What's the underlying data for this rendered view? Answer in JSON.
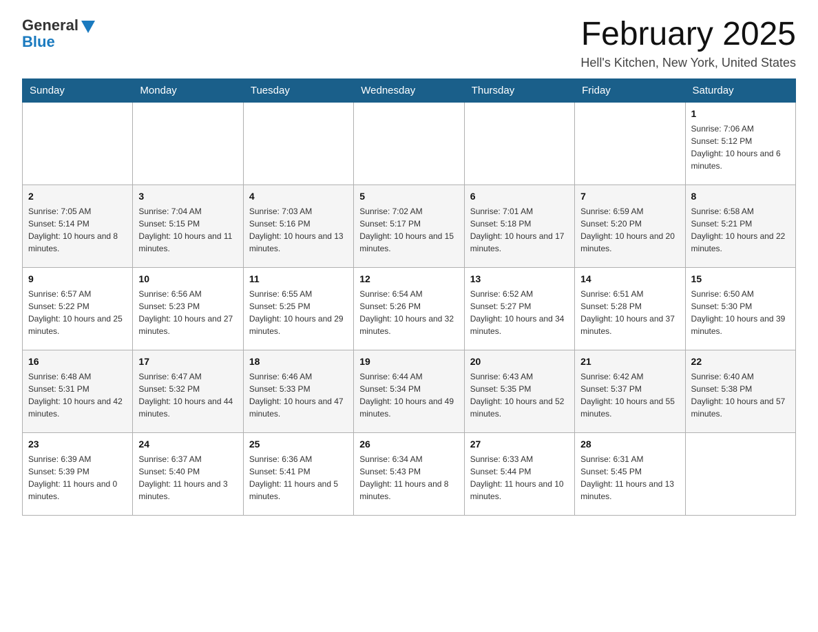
{
  "logo": {
    "general": "General",
    "blue": "Blue"
  },
  "header": {
    "title": "February 2025",
    "location": "Hell's Kitchen, New York, United States"
  },
  "days_of_week": [
    "Sunday",
    "Monday",
    "Tuesday",
    "Wednesday",
    "Thursday",
    "Friday",
    "Saturday"
  ],
  "weeks": [
    [
      {
        "day": "",
        "info": ""
      },
      {
        "day": "",
        "info": ""
      },
      {
        "day": "",
        "info": ""
      },
      {
        "day": "",
        "info": ""
      },
      {
        "day": "",
        "info": ""
      },
      {
        "day": "",
        "info": ""
      },
      {
        "day": "1",
        "info": "Sunrise: 7:06 AM\nSunset: 5:12 PM\nDaylight: 10 hours and 6 minutes."
      }
    ],
    [
      {
        "day": "2",
        "info": "Sunrise: 7:05 AM\nSunset: 5:14 PM\nDaylight: 10 hours and 8 minutes."
      },
      {
        "day": "3",
        "info": "Sunrise: 7:04 AM\nSunset: 5:15 PM\nDaylight: 10 hours and 11 minutes."
      },
      {
        "day": "4",
        "info": "Sunrise: 7:03 AM\nSunset: 5:16 PM\nDaylight: 10 hours and 13 minutes."
      },
      {
        "day": "5",
        "info": "Sunrise: 7:02 AM\nSunset: 5:17 PM\nDaylight: 10 hours and 15 minutes."
      },
      {
        "day": "6",
        "info": "Sunrise: 7:01 AM\nSunset: 5:18 PM\nDaylight: 10 hours and 17 minutes."
      },
      {
        "day": "7",
        "info": "Sunrise: 6:59 AM\nSunset: 5:20 PM\nDaylight: 10 hours and 20 minutes."
      },
      {
        "day": "8",
        "info": "Sunrise: 6:58 AM\nSunset: 5:21 PM\nDaylight: 10 hours and 22 minutes."
      }
    ],
    [
      {
        "day": "9",
        "info": "Sunrise: 6:57 AM\nSunset: 5:22 PM\nDaylight: 10 hours and 25 minutes."
      },
      {
        "day": "10",
        "info": "Sunrise: 6:56 AM\nSunset: 5:23 PM\nDaylight: 10 hours and 27 minutes."
      },
      {
        "day": "11",
        "info": "Sunrise: 6:55 AM\nSunset: 5:25 PM\nDaylight: 10 hours and 29 minutes."
      },
      {
        "day": "12",
        "info": "Sunrise: 6:54 AM\nSunset: 5:26 PM\nDaylight: 10 hours and 32 minutes."
      },
      {
        "day": "13",
        "info": "Sunrise: 6:52 AM\nSunset: 5:27 PM\nDaylight: 10 hours and 34 minutes."
      },
      {
        "day": "14",
        "info": "Sunrise: 6:51 AM\nSunset: 5:28 PM\nDaylight: 10 hours and 37 minutes."
      },
      {
        "day": "15",
        "info": "Sunrise: 6:50 AM\nSunset: 5:30 PM\nDaylight: 10 hours and 39 minutes."
      }
    ],
    [
      {
        "day": "16",
        "info": "Sunrise: 6:48 AM\nSunset: 5:31 PM\nDaylight: 10 hours and 42 minutes."
      },
      {
        "day": "17",
        "info": "Sunrise: 6:47 AM\nSunset: 5:32 PM\nDaylight: 10 hours and 44 minutes."
      },
      {
        "day": "18",
        "info": "Sunrise: 6:46 AM\nSunset: 5:33 PM\nDaylight: 10 hours and 47 minutes."
      },
      {
        "day": "19",
        "info": "Sunrise: 6:44 AM\nSunset: 5:34 PM\nDaylight: 10 hours and 49 minutes."
      },
      {
        "day": "20",
        "info": "Sunrise: 6:43 AM\nSunset: 5:35 PM\nDaylight: 10 hours and 52 minutes."
      },
      {
        "day": "21",
        "info": "Sunrise: 6:42 AM\nSunset: 5:37 PM\nDaylight: 10 hours and 55 minutes."
      },
      {
        "day": "22",
        "info": "Sunrise: 6:40 AM\nSunset: 5:38 PM\nDaylight: 10 hours and 57 minutes."
      }
    ],
    [
      {
        "day": "23",
        "info": "Sunrise: 6:39 AM\nSunset: 5:39 PM\nDaylight: 11 hours and 0 minutes."
      },
      {
        "day": "24",
        "info": "Sunrise: 6:37 AM\nSunset: 5:40 PM\nDaylight: 11 hours and 3 minutes."
      },
      {
        "day": "25",
        "info": "Sunrise: 6:36 AM\nSunset: 5:41 PM\nDaylight: 11 hours and 5 minutes."
      },
      {
        "day": "26",
        "info": "Sunrise: 6:34 AM\nSunset: 5:43 PM\nDaylight: 11 hours and 8 minutes."
      },
      {
        "day": "27",
        "info": "Sunrise: 6:33 AM\nSunset: 5:44 PM\nDaylight: 11 hours and 10 minutes."
      },
      {
        "day": "28",
        "info": "Sunrise: 6:31 AM\nSunset: 5:45 PM\nDaylight: 11 hours and 13 minutes."
      },
      {
        "day": "",
        "info": ""
      }
    ]
  ]
}
